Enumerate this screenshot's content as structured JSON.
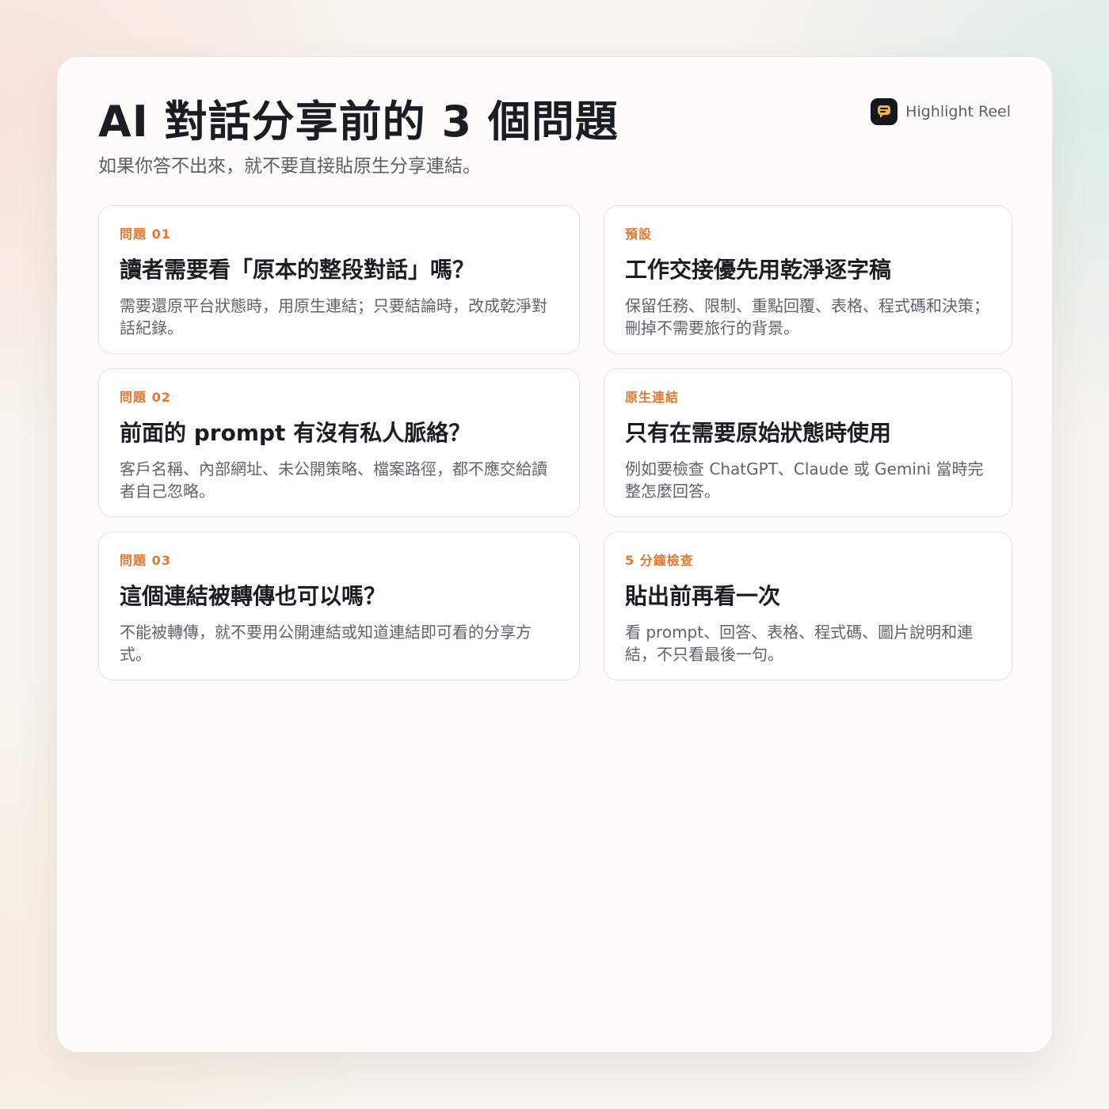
{
  "header": {
    "title": "AI 對話分享前的 3 個問題",
    "subtitle": "如果你答不出來，就不要直接貼原生分享連結。"
  },
  "brand": {
    "name": "Highlight Reel",
    "icon": "chat-bubble-icon",
    "accent": "#f2b24a"
  },
  "cards": [
    {
      "tag": "問題 01",
      "heading": "讀者需要看「原本的整段對話」嗎？",
      "body": "需要還原平台狀態時，用原生連結；只要結論時，改成乾淨對話紀錄。"
    },
    {
      "tag": "預設",
      "heading": "工作交接優先用乾淨逐字稿",
      "body": "保留任務、限制、重點回覆、表格、程式碼和決策；刪掉不需要旅行的背景。"
    },
    {
      "tag": "問題 02",
      "heading": "前面的 prompt 有沒有私人脈絡？",
      "body": "客戶名稱、內部網址、未公開策略、檔案路徑，都不應交給讀者自己忽略。"
    },
    {
      "tag": "原生連結",
      "heading": "只有在需要原始狀態時使用",
      "body": "例如要檢查 ChatGPT、Claude 或 Gemini 當時完整怎麼回答。"
    },
    {
      "tag": "問題 03",
      "heading": "這個連結被轉傳也可以嗎？",
      "body": "不能被轉傳，就不要用公開連結或知道連結即可看的分享方式。"
    },
    {
      "tag": "5 分鐘檢查",
      "heading": "貼出前再看一次",
      "body": "看 prompt、回答、表格、程式碼、圖片說明和連結，不只看最後一句。"
    }
  ],
  "colors": {
    "tag": "#e5772e",
    "heading": "#1b1d23",
    "body": "#5e636e"
  }
}
